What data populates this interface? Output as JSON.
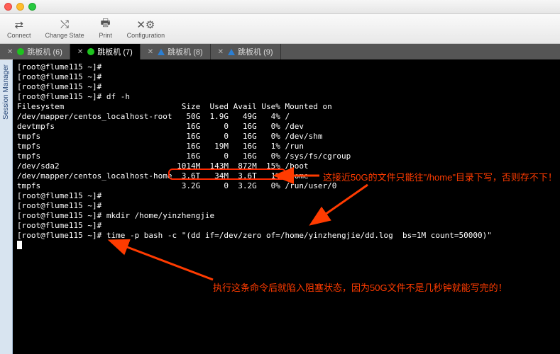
{
  "window": {
    "title": ""
  },
  "toolbar": {
    "connect": "Connect",
    "change_state": "Change State",
    "print": "Print",
    "configuration": "Configuration"
  },
  "tabs": [
    {
      "label": "跳板机 (6)",
      "active": false,
      "status": "green"
    },
    {
      "label": "跳板机 (7)",
      "active": true,
      "status": "green"
    },
    {
      "label": "跳板机 (8)",
      "active": false,
      "status": "warn"
    },
    {
      "label": "跳板机 (9)",
      "active": false,
      "status": "warn"
    }
  ],
  "sidebar": {
    "label": "Session Manager"
  },
  "terminal": {
    "prompt": "[root@flume115 ~]#",
    "lines": [
      "[root@flume115 ~]# ",
      "[root@flume115 ~]# ",
      "[root@flume115 ~]# ",
      "[root@flume115 ~]# df -h",
      "Filesystem                         Size  Used Avail Use% Mounted on",
      "/dev/mapper/centos_localhost-root   50G  1.9G   49G   4% /",
      "devtmpfs                            16G     0   16G   0% /dev",
      "tmpfs                               16G     0   16G   0% /dev/shm",
      "tmpfs                               16G   19M   16G   1% /run",
      "tmpfs                               16G     0   16G   0% /sys/fs/cgroup",
      "/dev/sda2                         1014M  143M  872M  15% /boot",
      "/dev/mapper/centos_localhost-home  3.6T   34M  3.6T   1% /home",
      "tmpfs                              3.2G     0  3.2G   0% /run/user/0",
      "[root@flume115 ~]# ",
      "[root@flume115 ~]# ",
      "[root@flume115 ~]# mkdir /home/yinzhengjie",
      "[root@flume115 ~]# ",
      "[root@flume115 ~]# time -p bash -c \"(dd if=/dev/zero of=/home/yinzhengjie/dd.log  bs=1M count=50000)\""
    ],
    "df": {
      "header": [
        "Filesystem",
        "Size",
        "Used",
        "Avail",
        "Use%",
        "Mounted on"
      ],
      "rows": [
        {
          "fs": "/dev/mapper/centos_localhost-root",
          "size": "50G",
          "used": "1.9G",
          "avail": "49G",
          "usep": "4%",
          "mount": "/"
        },
        {
          "fs": "devtmpfs",
          "size": "16G",
          "used": "0",
          "avail": "16G",
          "usep": "0%",
          "mount": "/dev"
        },
        {
          "fs": "tmpfs",
          "size": "16G",
          "used": "0",
          "avail": "16G",
          "usep": "0%",
          "mount": "/dev/shm"
        },
        {
          "fs": "tmpfs",
          "size": "16G",
          "used": "19M",
          "avail": "16G",
          "usep": "1%",
          "mount": "/run"
        },
        {
          "fs": "tmpfs",
          "size": "16G",
          "used": "0",
          "avail": "16G",
          "usep": "0%",
          "mount": "/sys/fs/cgroup"
        },
        {
          "fs": "/dev/sda2",
          "size": "1014M",
          "used": "143M",
          "avail": "872M",
          "usep": "15%",
          "mount": "/boot"
        },
        {
          "fs": "/dev/mapper/centos_localhost-home",
          "size": "3.6T",
          "used": "34M",
          "avail": "3.6T",
          "usep": "1%",
          "mount": "/home"
        },
        {
          "fs": "tmpfs",
          "size": "3.2G",
          "used": "0",
          "avail": "3.2G",
          "usep": "0%",
          "mount": "/run/user/0"
        }
      ]
    },
    "commands": [
      "df -h",
      "mkdir /home/yinzhengjie",
      "time -p bash -c \"(dd if=/dev/zero of=/home/yinzhengjie/dd.log  bs=1M count=50000)\""
    ]
  },
  "annotations": {
    "top": "这接近50G的文件只能往\"/home\"目录下写，否则存不下！",
    "bottom": "执行这条命令后就陷入阻塞状态，因为50G文件不是几秒钟就能写完的！"
  },
  "colors": {
    "annotation": "#ff3b00",
    "terminal_bg": "#000000",
    "terminal_fg": "#ffffff"
  }
}
